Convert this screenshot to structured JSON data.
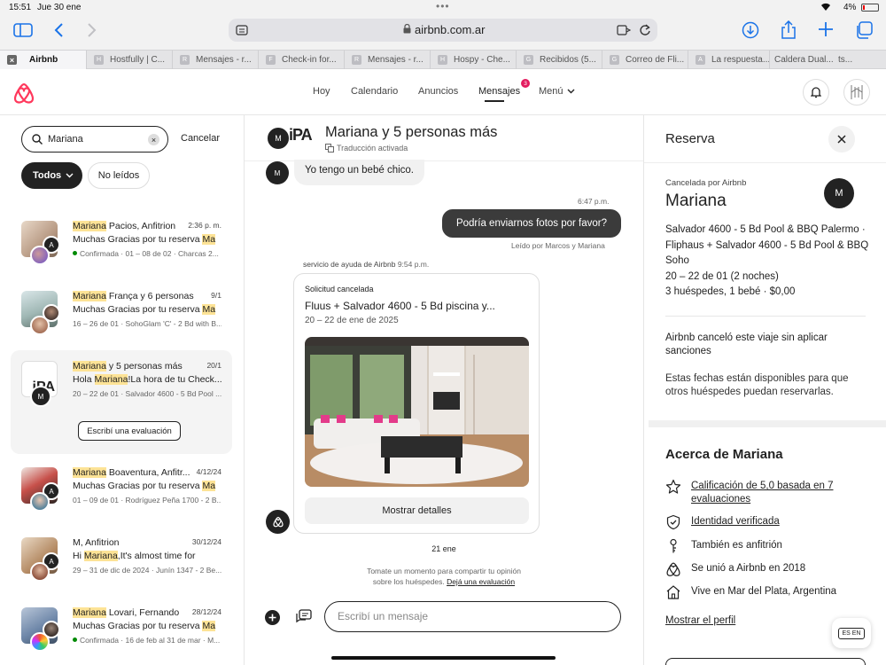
{
  "statusbar": {
    "time": "15:51",
    "date": "Jue 30 ene",
    "battery": "4%"
  },
  "browser": {
    "url": "airbnb.com.ar",
    "tabs": [
      {
        "label": "Airbnb",
        "fav": "",
        "active": true
      },
      {
        "label": "Hostfully | C...",
        "fav": "H"
      },
      {
        "label": "Mensajes - r...",
        "fav": "R"
      },
      {
        "label": "Check-in for...",
        "fav": "F"
      },
      {
        "label": "Mensajes - r...",
        "fav": "R"
      },
      {
        "label": "Hospy - Che...",
        "fav": "H"
      },
      {
        "label": "Recibidos (5...",
        "fav": "G"
      },
      {
        "label": "Correo de Fli...",
        "fav": "G"
      },
      {
        "label": "La respuesta...",
        "fav": "A"
      },
      {
        "label": "Caldera Dual...",
        "fav": ""
      },
      {
        "label": "ts...",
        "fav": ""
      }
    ]
  },
  "nav": {
    "items": [
      "Hoy",
      "Calendario",
      "Anuncios",
      "Mensajes",
      "Menú"
    ],
    "messages_badge": "3"
  },
  "search": {
    "value": "Mariana",
    "cancel": "Cancelar"
  },
  "filters": {
    "all": "Todos",
    "unread": "No leídos"
  },
  "conversations": [
    {
      "name": "Mariana",
      "rest": " Pacios, Anfitrion",
      "date": "2:36 p. m.",
      "msg": "Muchas Gracias por tu reserva ",
      "msg_hl": "Ma",
      "meta": "Confirmada · 01 – 08 de 02 · Charcas 2...",
      "dot": true
    },
    {
      "name": "Mariana",
      "rest": " França y 6 personas m...",
      "date": "9/1",
      "msg": "Muchas Gracias por tu reserva ",
      "msg_hl": "Ma",
      "meta": "16 – 26 de 01 · SohoGlam 'C' - 2 Bd with B..."
    },
    {
      "name": "Mariana",
      "rest": " y 5 personas más",
      "date": "20/1",
      "msg_pre": "Hola ",
      "msg_hl_mid": "Mariana",
      "msg_post": "!La hora de tu Check...",
      "meta": "20 – 22 de 01 · Salvador 4600 - 5 Bd Pool ...",
      "action": "Escribí una evaluación"
    },
    {
      "name": "Mariana",
      "rest": " Boaventura, Anfitr...",
      "date": "4/12/24",
      "msg": "Muchas Gracias por tu reserva ",
      "msg_hl": "Ma",
      "meta": "01 – 09 de 01 · Rodríguez Peña 1700 - 2 B..."
    },
    {
      "name_plain": "M, Anfitrion",
      "date": "30/12/24",
      "msg_pre": "Hi ",
      "msg_hl_mid": "Mariana",
      "msg_post": ",It's almost time for",
      "meta": "29 – 31 de dic de 2024 · Junín 1347 - 2 Be..."
    },
    {
      "name": "Mariana",
      "rest": " Lovari, Fernando",
      "date": "28/12/24",
      "msg": "Muchas Gracias por tu reserva ",
      "msg_hl": "Ma",
      "meta": "Confirmada · 16 de feb al 31 de mar · M...",
      "dot": true
    }
  ],
  "chat": {
    "title": "Mariana y 5 personas más",
    "subtitle": "Traducción activada",
    "avatar": "M",
    "msg1": "Yo tengo un bebé chico.",
    "time_out": "6:47 p.m.",
    "msg_out": "Podría enviarnos fotos por favor?",
    "read": "Leído por Marcos y Mariana",
    "support_sender": "servicio de ayuda de Airbnb",
    "support_time": "9:54 p.m.",
    "card_label": "Solicitud cancelada",
    "card_title": "Fluus + Salvador 4600 - 5 Bd piscina y...",
    "card_dates": "20 – 22 de ene de 2025",
    "card_button": "Mostrar detalles",
    "day": "21 ene",
    "review_line1": "Tomate un momento para compartir tu opinión",
    "review_line2": "sobre los huéspedes. ",
    "review_link": "Dejá una evaluación",
    "input_placeholder": "Escribí un mensaje"
  },
  "reservation": {
    "header": "Reserva",
    "cancelled_by": "Cancelada por Airbnb",
    "guest": "Mariana",
    "avatar": "M",
    "listing": "Salvador 4600 - 5 Bd Pool & BBQ Palermo · Fliphaus + Salvador 4600 - 5 Bd Pool & BBQ Soho",
    "dates": "20 – 22 de 01 (2 noches)",
    "guests": "3 huéspedes, 1 bebé · $0,00",
    "cancel_title": "Airbnb canceló este viaje sin aplicar sanciones",
    "cancel_text": "Estas fechas están disponibles para que otros huéspedes puedan reservarlas.",
    "about_title": "Acerca de Mariana",
    "rating": "Calificación de 5,0 basada en 7 evaluaciones",
    "verified": "Identidad verificada",
    "host": "También es anfitrión",
    "joined": "Se unió a Airbnb en 2018",
    "lives": "Vive en Mar del Plata, Argentina",
    "profile": "Mostrar el perfil",
    "translate_badge": "ES EN"
  },
  "colors": {
    "brand": "#ff385c",
    "highlight": "#fde396",
    "green": "#008a05"
  }
}
